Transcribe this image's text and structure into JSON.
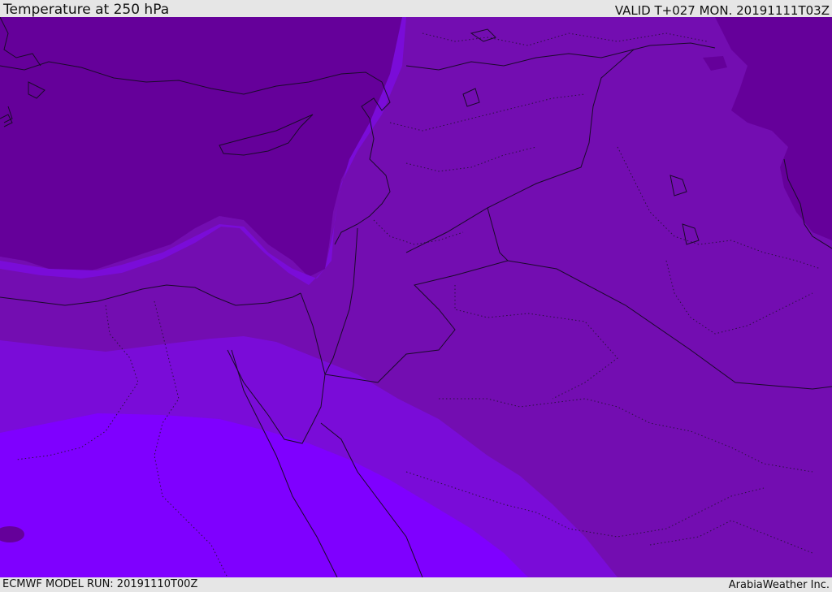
{
  "header": {
    "title": "Temperature at 250 hPa",
    "valid": "VALID T+027 MON. 20191111T03Z"
  },
  "footer": {
    "model_run": "ECMWF MODEL RUN: 20191110T00Z",
    "credit": "ArabiaWeather Inc."
  },
  "colors": {
    "band_coldest": "#65009a",
    "band_cold": "#730db1",
    "band_mid": "#7a0cd8",
    "band_warm": "#7f00ff",
    "coastline": "#1a0a2a"
  }
}
